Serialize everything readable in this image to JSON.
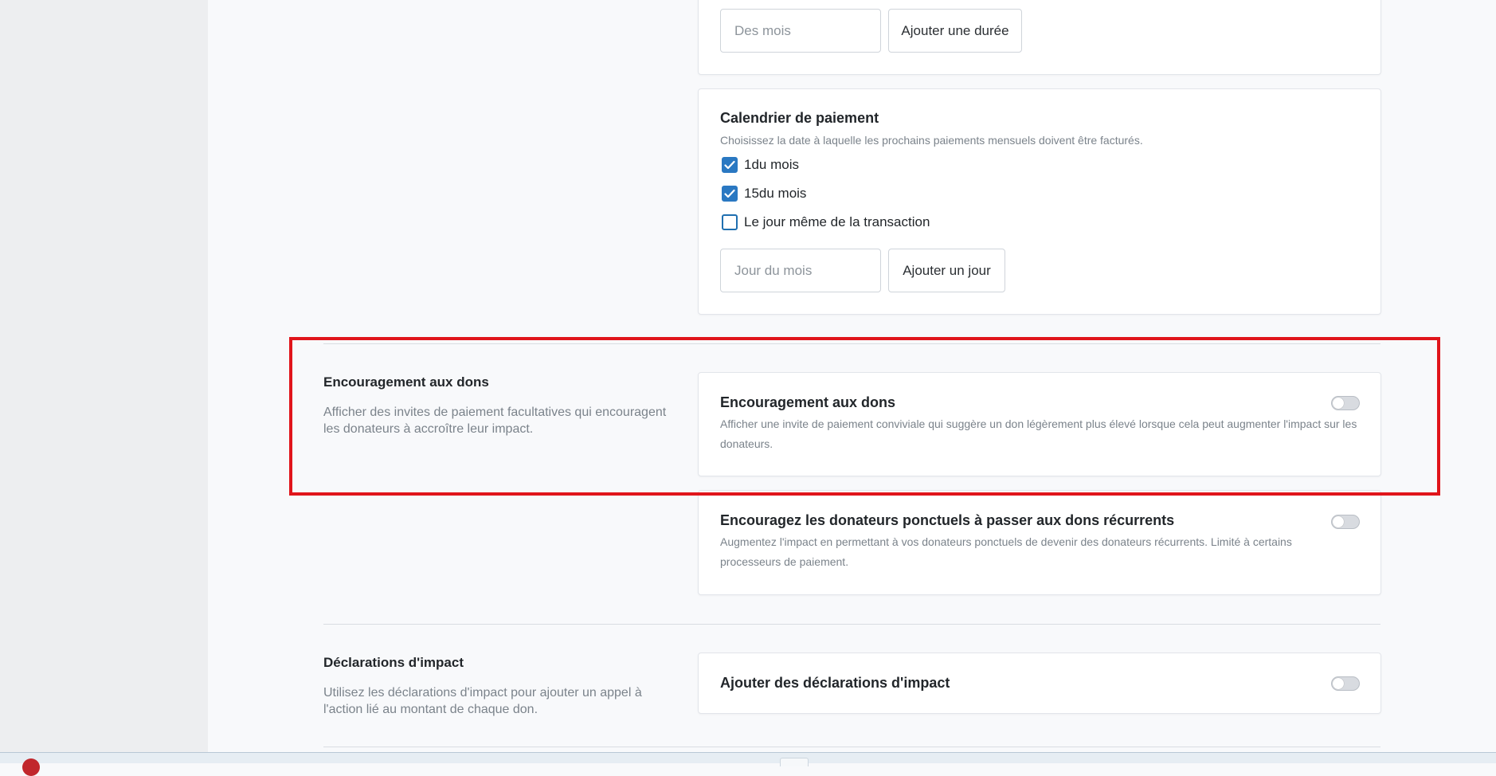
{
  "duration": {
    "input_placeholder": "Des mois",
    "add_button": "Ajouter une durée"
  },
  "schedule": {
    "title": "Calendrier de paiement",
    "description": "Choisissez la date à laquelle les prochains paiements mensuels doivent être facturés.",
    "options": [
      {
        "label": "1du mois",
        "checked": true
      },
      {
        "label": "15du mois",
        "checked": true
      },
      {
        "label": "Le jour même de la transaction",
        "checked": false
      }
    ],
    "day_input_placeholder": "Jour du mois",
    "add_day_button": "Ajouter un jour"
  },
  "encouragement": {
    "section_title": "Encouragement aux dons",
    "section_description": "Afficher des invites de paiement facultatives qui encouragent les donateurs à accroître leur impact.",
    "upsell": {
      "title": "Encouragement aux dons",
      "description": "Afficher une invite de paiement conviviale qui suggère un don légèrement plus élevé lorsque cela peut augmenter l'impact sur les donateurs.",
      "enabled": false
    },
    "recurring": {
      "title": "Encouragez les donateurs ponctuels à passer aux dons récurrents",
      "description": "Augmentez l'impact en permettant à vos donateurs ponctuels de devenir des donateurs récurrents. Limité à certains processeurs de paiement.",
      "enabled": false
    }
  },
  "impact": {
    "section_title": "Déclarations d'impact",
    "section_description": "Utilisez les déclarations d'impact pour ajouter un appel à l'action lié au montant de chaque don.",
    "toggle_label": "Ajouter des déclarations d'impact",
    "enabled": false
  },
  "colors": {
    "highlight": "#e0151b",
    "checkbox": "#2a78c2"
  }
}
